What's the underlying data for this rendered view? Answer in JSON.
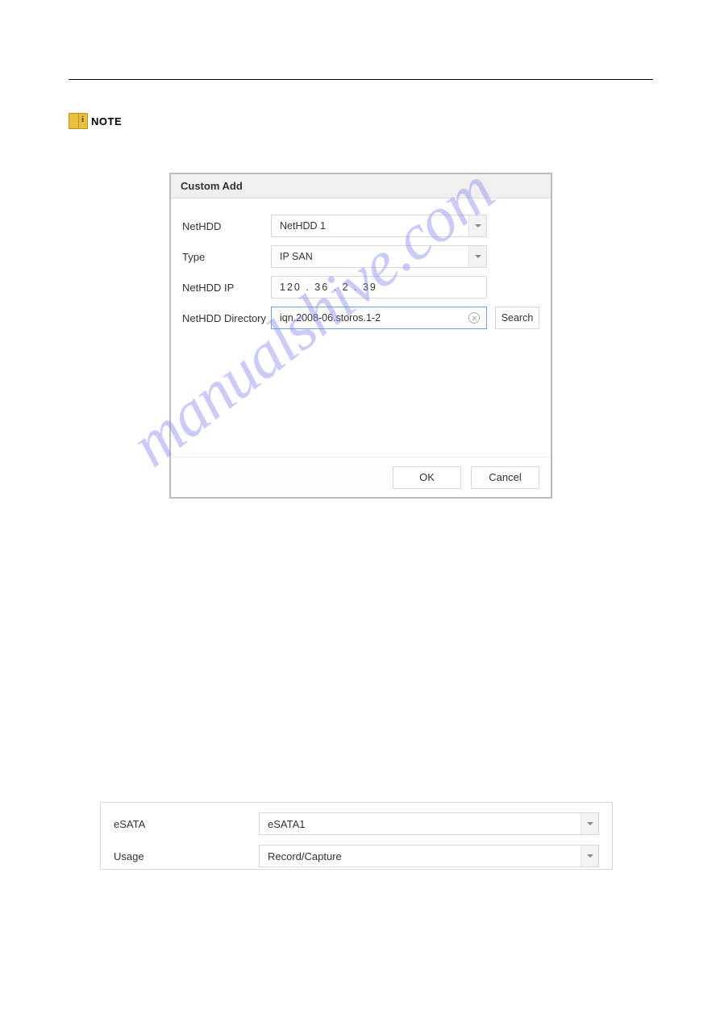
{
  "note_label": "NOTE",
  "dialog": {
    "title": "Custom Add",
    "fields": {
      "nethdd_label": "NetHDD",
      "nethdd_value": "NetHDD 1",
      "type_label": "Type",
      "type_value": "IP SAN",
      "ip_label": "NetHDD IP",
      "ip_value": "120  . 36   . 2     . 39",
      "dir_label": "NetHDD Directory",
      "dir_value": "iqn.2008-06.storos.1-2",
      "search_label": "Search"
    },
    "footer": {
      "ok": "OK",
      "cancel": "Cancel"
    }
  },
  "watermark": "manualshive.com",
  "esata": {
    "label1": "eSATA",
    "value1": "eSATA1",
    "label2": "Usage",
    "value2": "Record/Capture"
  }
}
